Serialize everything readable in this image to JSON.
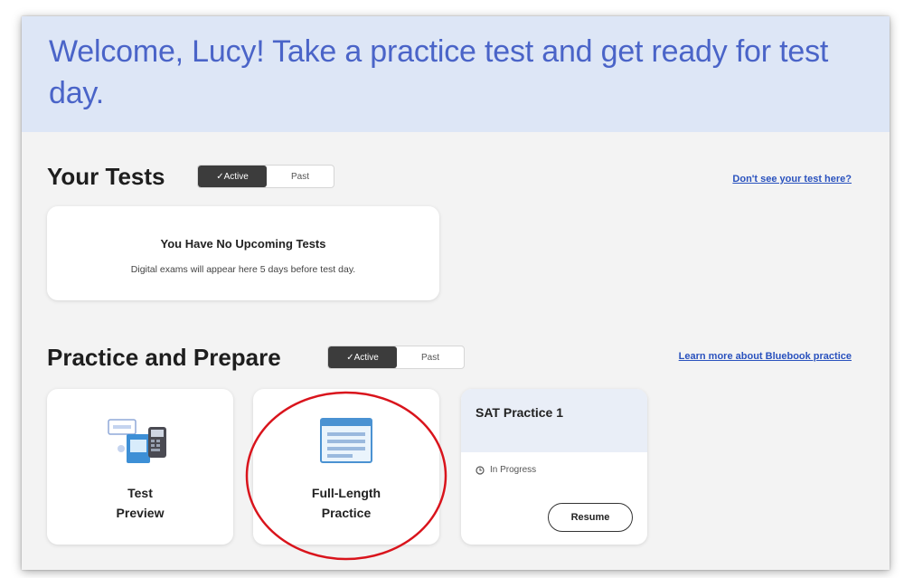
{
  "banner": {
    "welcome": "Welcome, Lucy! Take a practice test and get ready for test day."
  },
  "your_tests": {
    "title": "Your Tests",
    "toggle": {
      "active": "✓Active",
      "past": "Past"
    },
    "help_link": "Don't see your test here?",
    "empty_card": {
      "title": "You Have No Upcoming Tests",
      "description": "Digital exams will appear here 5 days before test day."
    }
  },
  "practice": {
    "title": "Practice and Prepare",
    "toggle": {
      "active": "✓Active",
      "past": "Past"
    },
    "learn_link": "Learn more about Bluebook practice",
    "cards": [
      {
        "label_line1": "Test",
        "label_line2": "Preview",
        "icon": "test-preview-icon"
      },
      {
        "label_line1": "Full-Length",
        "label_line2": "Practice",
        "icon": "full-length-practice-icon"
      }
    ],
    "sat_card": {
      "title": "SAT Practice 1",
      "status": "In Progress",
      "status_icon": "clock-icon",
      "resume_label": "Resume"
    }
  },
  "colors": {
    "banner_bg": "#dde6f6",
    "welcome_text": "#4a64c8",
    "link": "#2a52be",
    "annotation_circle": "#d9141c"
  }
}
